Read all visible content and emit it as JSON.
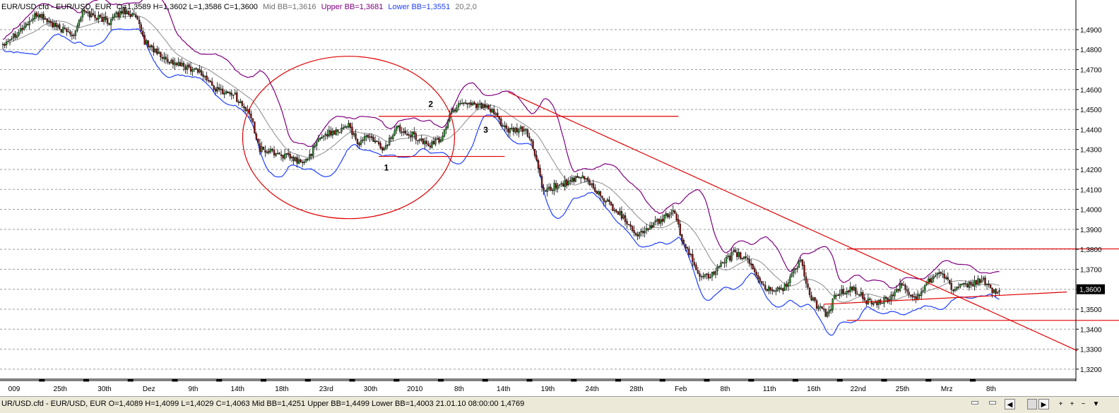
{
  "header": {
    "symbol": "EUR/USD.cfd - EUR/USD, EUR",
    "ohlc": "O=1,3589 H=1,3602 L=1,3586 C=1,3600",
    "mid_bb": "Mid BB=1,3616",
    "upper_bb": "Upper BB=1,3681",
    "lower_bb": "Lower BB=1,3551",
    "params": "20,2,0"
  },
  "status": {
    "text": "UR/USD.cfd - EUR/USD, EUR O=1,4089 H=1,4099 L=1,4029 C=1,4063  Mid BB=1,4251 Upper BB=1,4499 Lower BB=1,4003  21.01.10 08:00:00 1,4769",
    "nav_left": "◀",
    "nav_right": "▶",
    "plus": "+",
    "minus": "−"
  },
  "colors": {
    "candle_up": "#2e8b2e",
    "candle_down": "#8b1a1a",
    "mid_bb": "#8c8c8c",
    "upper_bb": "#800080",
    "lower_bb": "#1f3fff",
    "annotation": "#e00000"
  },
  "chart_data": {
    "type": "candlestick",
    "ylim": [
      1.315,
      1.502
    ],
    "grid": true,
    "y_ticks": [
      "1,4900",
      "1,4800",
      "1,4700",
      "1,4600",
      "1,4500",
      "1,4400",
      "1,4300",
      "1,4200",
      "1,4100",
      "1,4000",
      "1,3900",
      "1,3800",
      "1,3700",
      "1,3600",
      "1,3500",
      "1,3400",
      "1,3300",
      "1,3200"
    ],
    "current_price": "1,3600",
    "x_labels": [
      {
        "i": 0,
        "label": "009"
      },
      {
        "i": 26,
        "label": "25th"
      },
      {
        "i": 51,
        "label": "30th"
      },
      {
        "i": 76,
        "label": "Dez"
      },
      {
        "i": 101,
        "label": "9th"
      },
      {
        "i": 126,
        "label": "14th"
      },
      {
        "i": 151,
        "label": "18th"
      },
      {
        "i": 176,
        "label": "23rd"
      },
      {
        "i": 201,
        "label": "30th"
      },
      {
        "i": 226,
        "label": "2010"
      },
      {
        "i": 251,
        "label": "8th"
      },
      {
        "i": 276,
        "label": "14th"
      },
      {
        "i": 301,
        "label": "19th"
      },
      {
        "i": 326,
        "label": "24th"
      },
      {
        "i": 351,
        "label": "28th"
      },
      {
        "i": 376,
        "label": "Feb"
      },
      {
        "i": 401,
        "label": "8th"
      },
      {
        "i": 426,
        "label": "11th"
      },
      {
        "i": 451,
        "label": "16th"
      },
      {
        "i": 476,
        "label": "22nd"
      },
      {
        "i": 501,
        "label": "25th"
      },
      {
        "i": 526,
        "label": "Mrz"
      },
      {
        "i": 551,
        "label": "8th"
      }
    ],
    "price_anchors": [
      [
        0,
        1.483
      ],
      [
        10,
        1.49
      ],
      [
        20,
        1.498
      ],
      [
        30,
        1.491
      ],
      [
        40,
        1.488
      ],
      [
        45,
        1.499
      ],
      [
        60,
        1.494
      ],
      [
        68,
        1.5
      ],
      [
        75,
        1.496
      ],
      [
        80,
        1.484
      ],
      [
        90,
        1.476
      ],
      [
        100,
        1.472
      ],
      [
        110,
        1.47
      ],
      [
        115,
        1.465
      ],
      [
        120,
        1.46
      ],
      [
        130,
        1.458
      ],
      [
        140,
        1.446
      ],
      [
        145,
        1.43
      ],
      [
        155,
        1.428
      ],
      [
        170,
        1.423
      ],
      [
        180,
        1.437
      ],
      [
        190,
        1.44
      ],
      [
        195,
        1.443
      ],
      [
        200,
        1.432
      ],
      [
        205,
        1.437
      ],
      [
        215,
        1.43
      ],
      [
        222,
        1.441
      ],
      [
        230,
        1.438
      ],
      [
        240,
        1.432
      ],
      [
        247,
        1.435
      ],
      [
        252,
        1.447
      ],
      [
        258,
        1.454
      ],
      [
        270,
        1.452
      ],
      [
        277,
        1.448
      ],
      [
        285,
        1.439
      ],
      [
        295,
        1.44
      ],
      [
        300,
        1.428
      ],
      [
        305,
        1.408
      ],
      [
        312,
        1.412
      ],
      [
        320,
        1.414
      ],
      [
        328,
        1.416
      ],
      [
        338,
        1.406
      ],
      [
        350,
        1.396
      ],
      [
        358,
        1.387
      ],
      [
        368,
        1.393
      ],
      [
        378,
        1.399
      ],
      [
        384,
        1.383
      ],
      [
        392,
        1.368
      ],
      [
        400,
        1.367
      ],
      [
        412,
        1.378
      ],
      [
        420,
        1.375
      ],
      [
        430,
        1.36
      ],
      [
        440,
        1.36
      ],
      [
        450,
        1.375
      ],
      [
        455,
        1.356
      ],
      [
        460,
        1.351
      ],
      [
        465,
        1.347
      ],
      [
        470,
        1.358
      ],
      [
        480,
        1.36
      ],
      [
        490,
        1.352
      ],
      [
        500,
        1.355
      ],
      [
        506,
        1.362
      ],
      [
        515,
        1.355
      ],
      [
        520,
        1.362
      ],
      [
        528,
        1.37
      ],
      [
        536,
        1.36
      ],
      [
        545,
        1.362
      ],
      [
        552,
        1.365
      ],
      [
        560,
        1.358
      ],
      [
        562,
        1.36
      ]
    ],
    "series": [
      {
        "name": "Mid BB"
      },
      {
        "name": "Upper BB"
      },
      {
        "name": "Lower BB"
      }
    ],
    "annotations": {
      "labels": [
        "1",
        "2",
        "3"
      ],
      "lines": [
        {
          "type": "horizontal",
          "x_range": [
            212,
            381
          ],
          "y": 1.4466
        },
        {
          "type": "horizontal",
          "x_range": [
            212,
            283
          ],
          "y": 1.4265
        },
        {
          "type": "trend",
          "from": [
            285,
            1.4587
          ],
          "to": [
            606,
            1.3292
          ]
        },
        {
          "type": "trend",
          "from": [
            463,
            1.3525
          ],
          "to": [
            600,
            1.3586
          ]
        },
        {
          "type": "horizontal",
          "x_range": [
            476,
            658
          ],
          "y": 1.3802
        },
        {
          "type": "horizontal",
          "x_range": [
            476,
            658
          ],
          "y": 1.3444
        }
      ]
    }
  }
}
